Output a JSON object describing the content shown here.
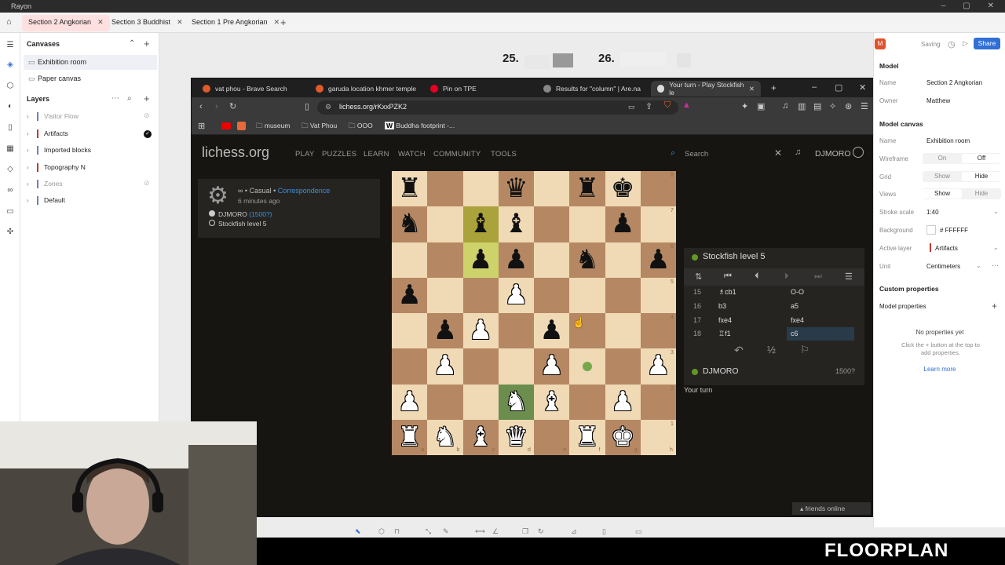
{
  "app": {
    "title": "Rayon",
    "window_controls": [
      "–",
      "▢",
      "✕"
    ]
  },
  "tabs": [
    {
      "label": "Section 2 Angkorian",
      "active": true
    },
    {
      "label": "Section 3 Buddhist",
      "active": false
    },
    {
      "label": "Section 1 Pre Angkorian",
      "active": false
    }
  ],
  "sidebar": {
    "canvases_title": "Canvases",
    "canvases": [
      {
        "label": "Exhibition room",
        "selected": true
      },
      {
        "label": "Paper canvas",
        "selected": false
      }
    ],
    "layers_title": "Layers",
    "layers": [
      {
        "label": "Visitor Flow",
        "color": "#6b7ec7",
        "dim": true,
        "hidden": true
      },
      {
        "label": "Artifacts",
        "color": "#c0392b",
        "dim": false,
        "check": true
      },
      {
        "label": "Imported blocks",
        "color": "#6b7ec7",
        "dim": false
      },
      {
        "label": "Topography N",
        "color": "#c0392b",
        "dim": false
      },
      {
        "label": "Zones",
        "color": "#6b7ec7",
        "dim": true,
        "hidden": true
      },
      {
        "label": "Default",
        "color": "#6b7ec7",
        "dim": false
      }
    ]
  },
  "canvas": {
    "num25": "25.",
    "num26": "26."
  },
  "browser": {
    "tabs": [
      {
        "label": "vat phou - Brave Search",
        "color": "#e05a2b"
      },
      {
        "label": "garuda location khmer temple",
        "color": "#e05a2b"
      },
      {
        "label": "Pin on TPE",
        "color": "#e60023"
      },
      {
        "label": "Results for \"column\" | Are.na",
        "color": "#888"
      },
      {
        "label": "Your turn - Play Stockfish le",
        "color": "#ddd",
        "active": true
      }
    ],
    "url": "lichess.org/rKxxPZK2",
    "bookmarks": [
      "museum",
      "Vat Phou",
      "OOO",
      "Buddha footprint -..."
    ],
    "site": {
      "logo": "lichess.org",
      "nav": [
        "PLAY",
        "PUZZLES",
        "LEARN",
        "WATCH",
        "COMMUNITY",
        "TOOLS"
      ],
      "search": "Search",
      "user": "DJMORO"
    },
    "game": {
      "mode_prefix": "∞ • Casual • ",
      "mode_link": "Correspondence",
      "time": "6 minutes ago",
      "white": "DJMORO",
      "white_rating": "(1500?)",
      "black": "Stockfish level 5"
    },
    "moves_panel": {
      "opponent": "Stockfish level 5",
      "moves": [
        {
          "n": "15",
          "w": "♗cb1",
          "b": "O-O"
        },
        {
          "n": "16",
          "w": "b3",
          "b": "a5"
        },
        {
          "n": "17",
          "w": "fxe4",
          "b": "fxe4"
        },
        {
          "n": "18",
          "w": "♖f1",
          "b": "c6",
          "current": true
        }
      ],
      "player": "DJMORO",
      "player_rating": "1500?",
      "status": "Your turn",
      "draw": "½"
    },
    "friends": "friends online"
  },
  "board": {
    "pieces": [
      "r..q.rk.",
      "n.bb..p.",
      "..pp.n.p",
      "p..P....",
      ".pP.p...",
      ".P..P..P",
      "P..NB.P.",
      "RNBQ.RK."
    ],
    "ranks": [
      "8",
      "7",
      "6",
      "5",
      "4",
      "3",
      "2",
      "1"
    ],
    "files": [
      "a",
      "b",
      "c",
      "d",
      "e",
      "f",
      "g",
      "h"
    ]
  },
  "props": {
    "user_initial": "M",
    "saving": "Saving",
    "share": "Share",
    "model_title": "Model",
    "name_label": "Name",
    "name_value": "Section 2 Angkorian",
    "owner_label": "Owner",
    "owner_value": "Matthew",
    "canvas_title": "Model canvas",
    "cname_value": "Exhibition room",
    "wireframe_label": "Wireframe",
    "on": "On",
    "off": "Off",
    "grid_label": "Grid",
    "show": "Show",
    "hide": "Hide",
    "views_label": "Views",
    "stroke_label": "Stroke scale",
    "stroke_value": "1:40",
    "bg_label": "Background",
    "bg_value": "# FFFFFF",
    "active_layer_label": "Active layer",
    "active_layer_value": "Artifacts",
    "unit_label": "Unit",
    "unit_value": "Centimeters",
    "custom_title": "Custom properties",
    "model_props": "Model properties",
    "none_title": "No properties yet",
    "none_desc": "Click the + button at the top to add properties.",
    "learn": "Learn more"
  },
  "brand": "FLOORPLAN"
}
